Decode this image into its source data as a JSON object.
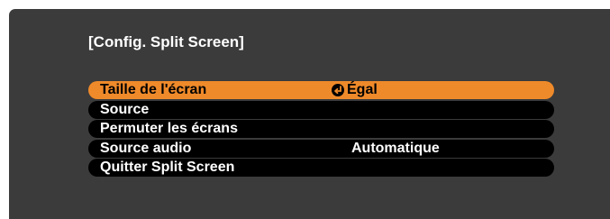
{
  "title": "[Config. Split Screen]",
  "menu": {
    "items": [
      {
        "label": "Taille de l'écran",
        "value": "Égal",
        "selected": true,
        "icon": "enter-icon"
      },
      {
        "label": "Source",
        "value": ""
      },
      {
        "label": "Permuter les écrans",
        "value": ""
      },
      {
        "label": "Source audio",
        "value": "Automatique"
      },
      {
        "label": "Quitter Split Screen",
        "value": ""
      }
    ]
  },
  "colors": {
    "panel_background": "#3b3b3b",
    "item_background": "#000000",
    "selected_background": "#ef8a2a",
    "text": "#ffffff"
  }
}
